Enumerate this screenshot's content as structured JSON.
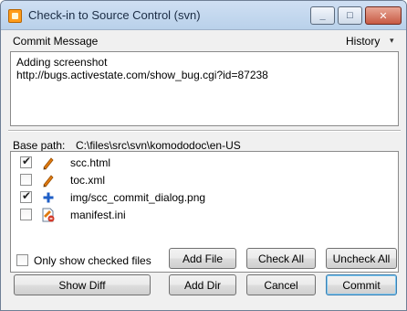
{
  "window": {
    "title": "Check-in to Source Control (svn)"
  },
  "commit": {
    "label": "Commit Message",
    "history_label": "History",
    "history_arrow": "▾",
    "message_lines": [
      "Adding screenshot",
      "http://bugs.activestate.com/show_bug.cgi?id=87238"
    ]
  },
  "base_path": {
    "label": "Base path:",
    "value": "C:\\files\\src\\svn\\komododoc\\en-US"
  },
  "files": [
    {
      "name": "scc.html",
      "checked": true,
      "status_icon": "pencil-modified-icon"
    },
    {
      "name": "toc.xml",
      "checked": false,
      "status_icon": "pencil-modified-icon"
    },
    {
      "name": "img/scc_commit_dialog.png",
      "checked": true,
      "status_icon": "plus-added-icon"
    },
    {
      "name": "manifest.ini",
      "checked": false,
      "status_icon": "file-conflict-icon"
    }
  ],
  "options": {
    "only_checked_label": "Only show checked files"
  },
  "buttons": {
    "add_file": "Add File",
    "check_all": "Check All",
    "uncheck_all": "Uncheck All",
    "show_diff": "Show Diff",
    "add_dir": "Add Dir",
    "cancel": "Cancel",
    "commit": "Commit"
  },
  "colors": {
    "pencil": "#e07a10",
    "plus": "#1f5fc7",
    "conflict": "#d23a2a"
  }
}
